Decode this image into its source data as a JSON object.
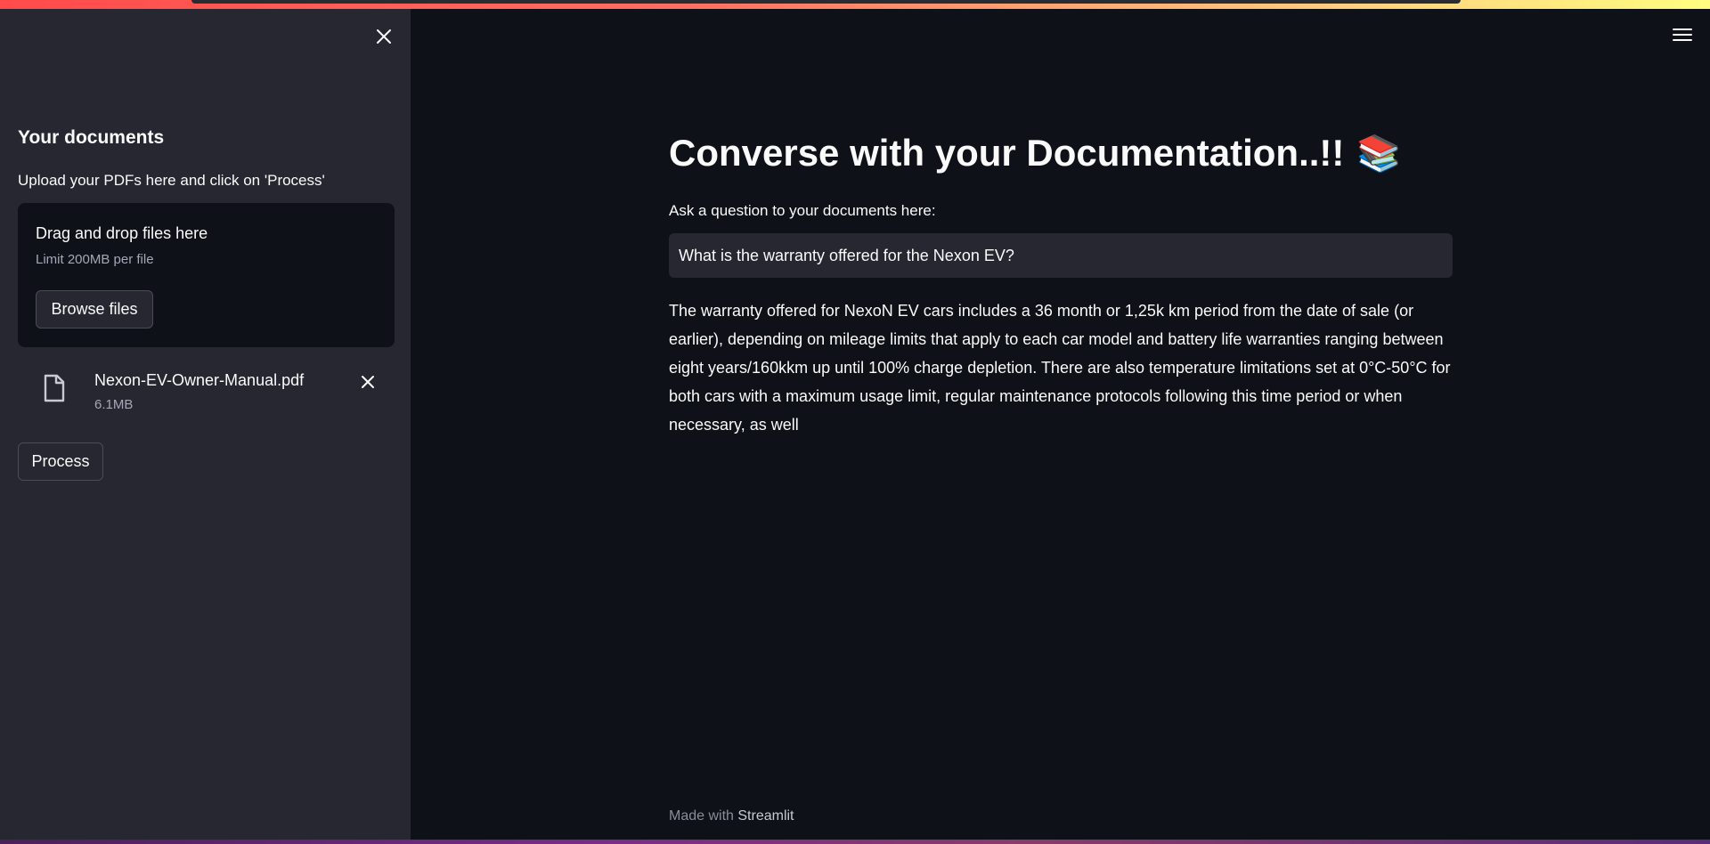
{
  "sidebar": {
    "heading": "Your documents",
    "hint": "Upload your PDFs here and click on 'Process'",
    "dropzone": {
      "title": "Drag and drop files here",
      "limit": "Limit 200MB per file",
      "browse_label": "Browse files"
    },
    "file": {
      "name": "Nexon-EV-Owner-Manual.pdf",
      "size": "6.1MB"
    },
    "process_label": "Process"
  },
  "main": {
    "title": "Converse with your Documentation..!!",
    "title_emoji": "📚",
    "question_label": "Ask a question to your documents here:",
    "question_value": "What is the warranty offered for the Nexon EV?",
    "answer": "The warranty offered for NexoN EV cars includes a 36 month or 1,25k km period from the date of sale (or earlier), depending on mileage limits that apply to each car model and battery life warranties ranging between eight years/160kkm up until 100% charge depletion. There are also temperature limitations set at 0°C-50°C for both cars with a maximum usage limit, regular maintenance protocols following this time period or when necessary, as well"
  },
  "footer": {
    "prefix": "Made with",
    "brand": "Streamlit"
  },
  "icons": {
    "close": "close-icon",
    "file": "file-icon",
    "menu": "hamburger-menu-icon"
  },
  "colors": {
    "background": "#0e1117",
    "sidebar": "#262730",
    "accent": "#ff4b4b"
  }
}
